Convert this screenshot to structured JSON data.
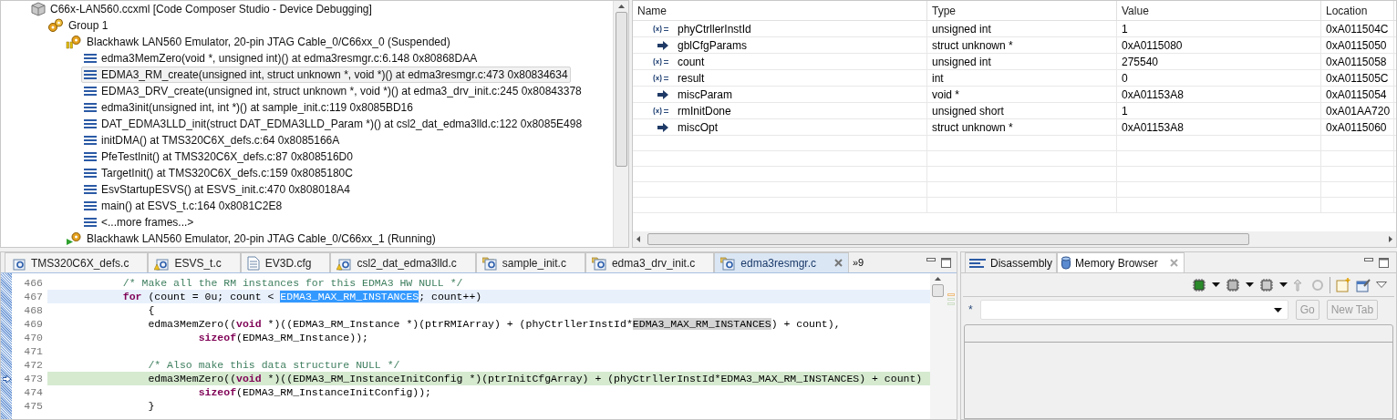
{
  "debug_tree": [
    {
      "kind": "session",
      "label": "C66x-LAN560.ccxml [Code Composer Studio - Device Debugging]",
      "children": [
        {
          "kind": "group",
          "label": "Group 1",
          "children": [
            {
              "kind": "suspended-core",
              "label": "Blackhawk LAN560 Emulator, 20-pin JTAG Cable_0/C66xx_0 (Suspended)",
              "children": [
                {
                  "kind": "frame",
                  "selected": false,
                  "label": "edma3MemZero(void *, unsigned int)() at edma3resmgr.c:6.148 0x80868DAA"
                },
                {
                  "kind": "frame",
                  "selected": true,
                  "label": "EDMA3_RM_create(unsigned int, struct unknown *, void *)() at edma3resmgr.c:473 0x80834634"
                },
                {
                  "kind": "frame",
                  "selected": false,
                  "label": "EDMA3_DRV_create(unsigned int, struct unknown *, void *)() at edma3_drv_init.c:245 0x80843378"
                },
                {
                  "kind": "frame",
                  "selected": false,
                  "label": "edma3init(unsigned int, int *)() at sample_init.c:119 0x8085BD16"
                },
                {
                  "kind": "frame",
                  "selected": false,
                  "label": "DAT_EDMA3LLD_init(struct DAT_EDMA3LLD_Param *)() at csl2_dat_edma3lld.c:122 0x8085E498"
                },
                {
                  "kind": "frame",
                  "selected": false,
                  "label": "initDMA() at TMS320C6X_defs.c:64 0x8085166A"
                },
                {
                  "kind": "frame",
                  "selected": false,
                  "label": "PfeTestInit() at TMS320C6X_defs.c:87 0x808516D0"
                },
                {
                  "kind": "frame",
                  "selected": false,
                  "label": "TargetInit() at TMS320C6X_defs.c:159 0x8085180C"
                },
                {
                  "kind": "frame",
                  "selected": false,
                  "label": "EsvStartupESVS() at ESVS_init.c:470 0x808018A4"
                },
                {
                  "kind": "frame",
                  "selected": false,
                  "label": "main() at ESVS_t.c:164 0x8081C2E8"
                },
                {
                  "kind": "frame",
                  "selected": false,
                  "label": "<...more frames...>"
                }
              ]
            },
            {
              "kind": "running-core",
              "label": "Blackhawk LAN560 Emulator, 20-pin JTAG Cable_0/C66xx_1 (Running)"
            }
          ]
        }
      ]
    }
  ],
  "variables": {
    "columns": [
      "Name",
      "Type",
      "Value",
      "Location"
    ],
    "rows": [
      {
        "kind": "value",
        "name": "phyCtrllerInstId",
        "type": "unsigned int",
        "value": "1",
        "location": "0xA011504C"
      },
      {
        "kind": "pointer",
        "name": "gblCfgParams",
        "type": "struct unknown *",
        "value": "0xA0115080",
        "location": "0xA0115050"
      },
      {
        "kind": "value",
        "name": "count",
        "type": "unsigned int",
        "value": "275540",
        "location": "0xA0115058"
      },
      {
        "kind": "value",
        "name": "result",
        "type": "int",
        "value": "0",
        "location": "0xA011505C"
      },
      {
        "kind": "pointer",
        "name": "miscParam",
        "type": "void *",
        "value": "0xA01153A8",
        "location": "0xA0115054"
      },
      {
        "kind": "value",
        "name": "rmInitDone",
        "type": "unsigned short",
        "value": "1",
        "location": "0xA01AA720"
      },
      {
        "kind": "pointer",
        "name": "miscOpt",
        "type": "struct unknown *",
        "value": "0xA01153A8",
        "location": "0xA0115060"
      }
    ]
  },
  "editor": {
    "tabs": [
      {
        "kind": "source",
        "label": "TMS320C6X_defs.c",
        "selected": false
      },
      {
        "kind": "warning",
        "label": "ESVS_t.c",
        "selected": false
      },
      {
        "kind": "config",
        "label": "EV3D.cfg",
        "selected": false
      },
      {
        "kind": "warning",
        "label": "csl2_dat_edma3lld.c",
        "selected": false
      },
      {
        "kind": "linked",
        "label": "sample_init.c",
        "selected": false
      },
      {
        "kind": "linked",
        "label": "edma3_drv_init.c",
        "selected": false
      },
      {
        "kind": "linked",
        "label": "edma3resmgr.c",
        "selected": true
      }
    ],
    "overflow": "»9",
    "lines": [
      {
        "number": "466",
        "current": false,
        "pc": false,
        "tokens": [
          {
            "kind": "comment",
            "text": "            /* Make all the RM instances for this EDMA3 HW NULL */"
          }
        ]
      },
      {
        "number": "467",
        "current": true,
        "pc": false,
        "tokens": [
          {
            "kind": "keyword",
            "text": "            for"
          },
          {
            "kind": "plain",
            "text": " (count = 0u; count < "
          },
          {
            "kind": "selection",
            "text": "EDMA3_MAX_RM_INSTANCES"
          },
          {
            "kind": "plain",
            "text": "; count++)"
          }
        ]
      },
      {
        "number": "468",
        "current": false,
        "pc": false,
        "tokens": [
          {
            "kind": "plain",
            "text": "                {"
          }
        ]
      },
      {
        "number": "469",
        "current": false,
        "pc": false,
        "tokens": [
          {
            "kind": "plain",
            "text": "                edma3MemZero(("
          },
          {
            "kind": "keyword",
            "text": "void"
          },
          {
            "kind": "plain",
            "text": " *)((EDMA3_RM_Instance *)(ptrRMIArray) + (phyCtrllerInstId*"
          },
          {
            "kind": "occurrence",
            "text": "EDMA3_MAX_RM_INSTANCES"
          },
          {
            "kind": "plain",
            "text": ") + count),"
          }
        ]
      },
      {
        "number": "470",
        "current": false,
        "pc": false,
        "tokens": [
          {
            "kind": "keyword",
            "text": "                        sizeof"
          },
          {
            "kind": "plain",
            "text": "(EDMA3_RM_Instance));"
          }
        ]
      },
      {
        "number": "471",
        "current": false,
        "pc": false
      },
      {
        "number": "472",
        "current": false,
        "pc": false,
        "tokens": [
          {
            "kind": "comment",
            "text": "                /* Also make this data structure NULL */"
          }
        ]
      },
      {
        "number": "473",
        "current": false,
        "pc": true,
        "tokens": [
          {
            "kind": "plain",
            "text": "                edma3MemZero(("
          },
          {
            "kind": "keyword",
            "text": "void"
          },
          {
            "kind": "plain",
            "text": " *)((EDMA3_RM_InstanceInitConfig *)(ptrInitCfgArray) + (phyCtrllerInstId*EDMA3_MAX_RM_INSTANCES) + count)"
          }
        ]
      },
      {
        "number": "474",
        "current": false,
        "pc": false,
        "tokens": [
          {
            "kind": "keyword",
            "text": "                        sizeof"
          },
          {
            "kind": "plain",
            "text": "(EDMA3_RM_InstanceInitConfig));"
          }
        ]
      },
      {
        "number": "475",
        "current": false,
        "pc": false,
        "tokens": [
          {
            "kind": "plain",
            "text": "                }"
          }
        ]
      }
    ]
  },
  "memory": {
    "tabs": [
      {
        "kind": "disassembly",
        "label": "Disassembly",
        "selected": false
      },
      {
        "kind": "memory",
        "label": "Memory Browser",
        "selected": true
      }
    ],
    "address_prefix": "*",
    "buttons": [
      {
        "label": "Go",
        "disabled": true
      },
      {
        "label": "New Tab",
        "disabled": true
      }
    ]
  }
}
